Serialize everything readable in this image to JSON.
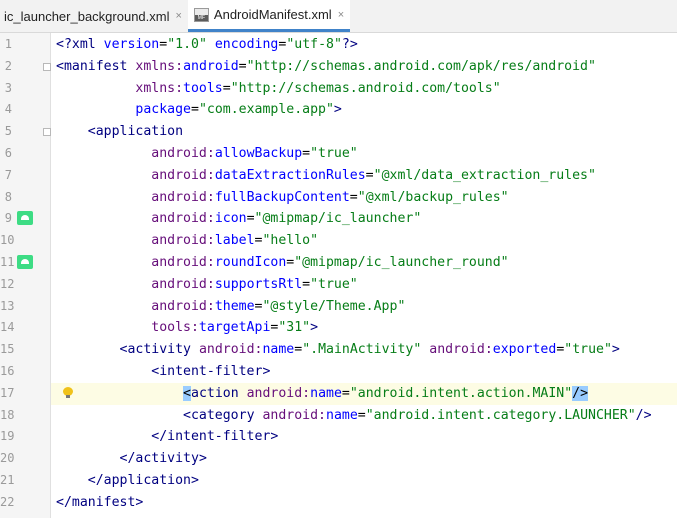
{
  "tabs": [
    {
      "label": "ic_launcher_background.xml",
      "active": false,
      "close": "×",
      "icon": "xml-file-icon"
    },
    {
      "label": "AndroidManifest.xml",
      "active": true,
      "close": "×",
      "icon": "manifest-file-icon",
      "icon_text": "MF"
    }
  ],
  "editor": {
    "current_line": 17,
    "lines": [
      {
        "n": "1",
        "code": "<?xml version=\"1.0\" encoding=\"utf-8\"?>"
      },
      {
        "n": "2",
        "code": "<manifest xmlns:android=\"http://schemas.android.com/apk/res/android\""
      },
      {
        "n": "3",
        "code": "          xmlns:tools=\"http://schemas.android.com/tools\""
      },
      {
        "n": "4",
        "code": "          package=\"com.example.app\">"
      },
      {
        "n": "5",
        "code": "    <application"
      },
      {
        "n": "6",
        "code": "            android:allowBackup=\"true\""
      },
      {
        "n": "7",
        "code": "            android:dataExtractionRules=\"@xml/data_extraction_rules\""
      },
      {
        "n": "8",
        "code": "            android:fullBackupContent=\"@xml/backup_rules\""
      },
      {
        "n": "9",
        "code": "            android:icon=\"@mipmap/ic_launcher\""
      },
      {
        "n": "10",
        "code": "            android:label=\"hello\""
      },
      {
        "n": "11",
        "code": "            android:roundIcon=\"@mipmap/ic_launcher_round\""
      },
      {
        "n": "12",
        "code": "            android:supportsRtl=\"true\""
      },
      {
        "n": "13",
        "code": "            android:theme=\"@style/Theme.App\""
      },
      {
        "n": "14",
        "code": "            tools:targetApi=\"31\">"
      },
      {
        "n": "15",
        "code": "        <activity android:name=\".MainActivity\" android:exported=\"true\">"
      },
      {
        "n": "16",
        "code": "            <intent-filter>"
      },
      {
        "n": "17",
        "code": "                <action android:name=\"android.intent.action.MAIN\"/>"
      },
      {
        "n": "18",
        "code": "                <category android:name=\"android.intent.category.LAUNCHER\"/>"
      },
      {
        "n": "19",
        "code": "            </intent-filter>"
      },
      {
        "n": "20",
        "code": "        </activity>"
      },
      {
        "n": "21",
        "code": "    </application>"
      },
      {
        "n": "22",
        "code": "</manifest>"
      }
    ]
  },
  "colors": {
    "tag": "#000080",
    "attr_namespace": "#660e7a",
    "attr_name": "#0000ff",
    "value": "#067d17",
    "current_line_bg": "#fdfce4",
    "android_icon": "#3ddc84",
    "active_tab_underline": "#4083c9"
  },
  "gutter_icons": [
    {
      "line": 9,
      "icon": "android-launcher-icon"
    },
    {
      "line": 11,
      "icon": "android-launcher-icon"
    },
    {
      "line": 17,
      "icon": "lightbulb-icon"
    }
  ]
}
